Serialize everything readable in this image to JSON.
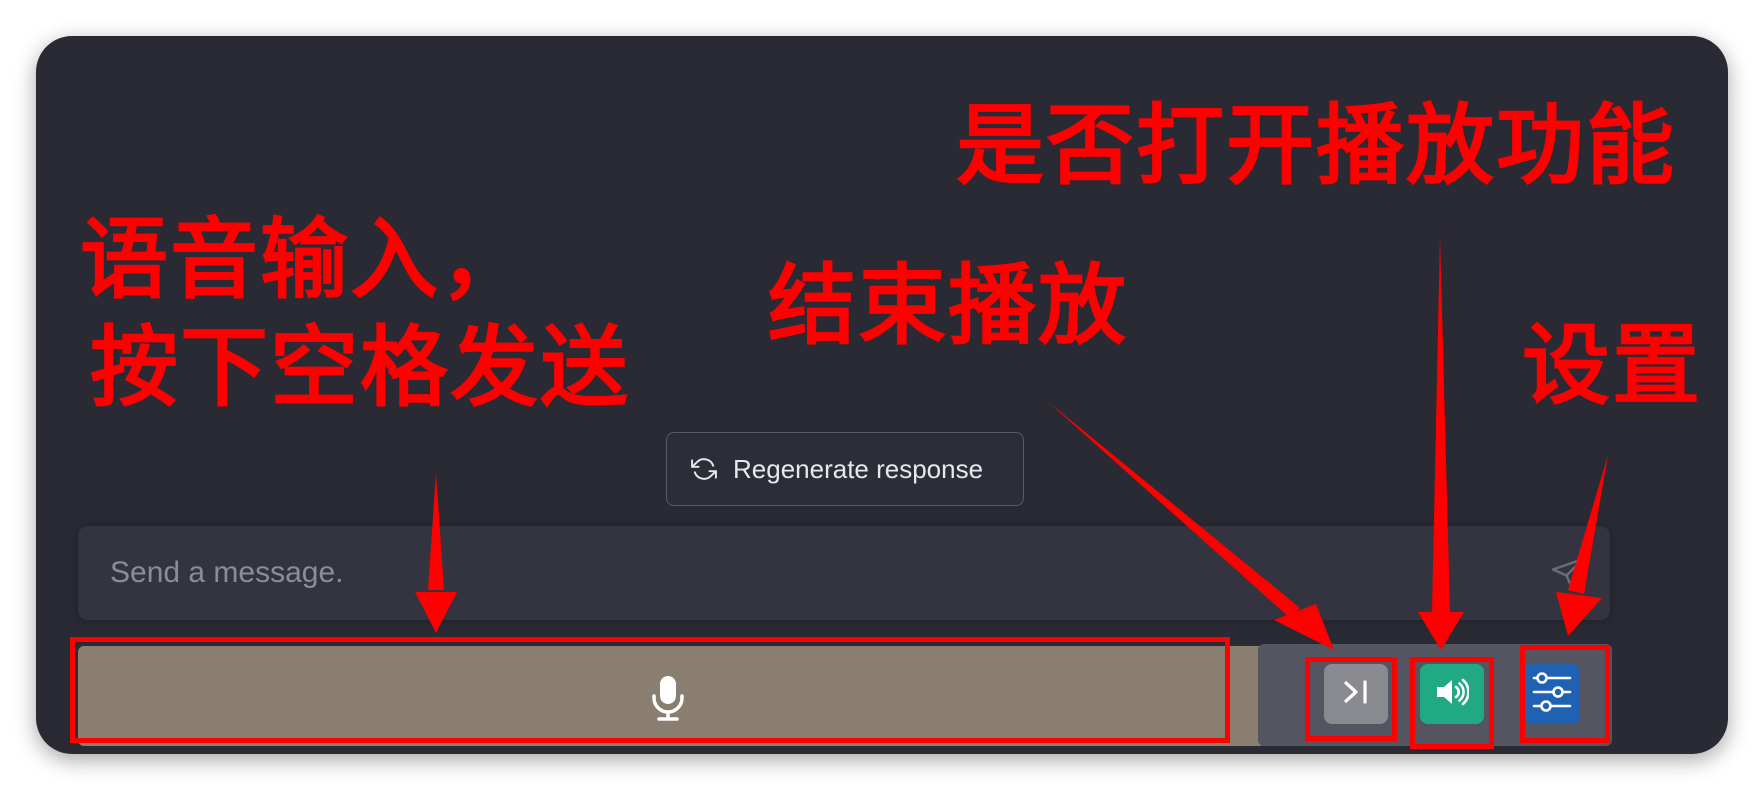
{
  "composer": {
    "regenerate_label": "Regenerate response",
    "placeholder": "Send a message."
  },
  "icons": {
    "regenerate": "refresh-icon",
    "send": "paper-plane-icon",
    "mic": "microphone-icon",
    "skip": "skip-end-icon",
    "sound": "speaker-icon",
    "settings": "sliders-icon"
  },
  "annotations": {
    "voice_input_line1": "语音输入，",
    "voice_input_line2": "按下空格发送",
    "end_playback": "结束播放",
    "toggle_playback": "是否打开播放功能",
    "settings": "设置"
  },
  "colors": {
    "background": "#292a33",
    "voice_bar": "#897e70",
    "sound_button": "#20a982",
    "settings_button": "#1f62b3",
    "skip_button": "#8a8b90",
    "annotation": "#ff0000"
  }
}
